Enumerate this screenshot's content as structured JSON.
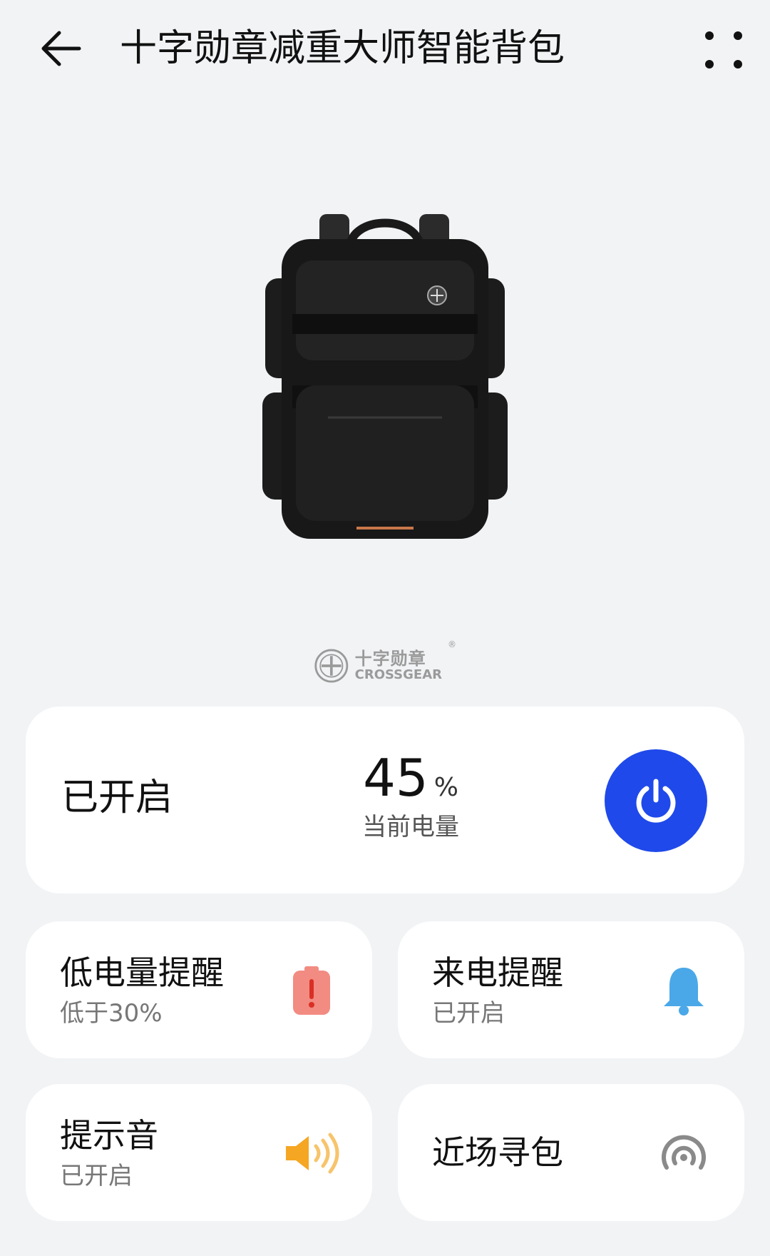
{
  "header": {
    "title": "十字勋章减重大师智能背包"
  },
  "brand": {
    "name_cn": "十字勋章",
    "name_en": "CROSSGEAR",
    "registered": "®"
  },
  "status": {
    "state_label": "已开启",
    "battery_value": "45",
    "battery_unit": "%",
    "battery_label": "当前电量",
    "power_color": "#1f49ea"
  },
  "tiles": [
    {
      "title": "低电量提醒",
      "subtitle": "低于30%",
      "icon": "low-battery-icon",
      "color": "#f28b82"
    },
    {
      "title": "来电提醒",
      "subtitle": "已开启",
      "icon": "bell-icon",
      "color": "#4aa8e8"
    },
    {
      "title": "提示音",
      "subtitle": "已开启",
      "icon": "speaker-icon",
      "color": "#f5a623"
    },
    {
      "title": "近场寻包",
      "subtitle": "",
      "icon": "nearby-search-icon",
      "color": "#8a8a8a"
    }
  ]
}
